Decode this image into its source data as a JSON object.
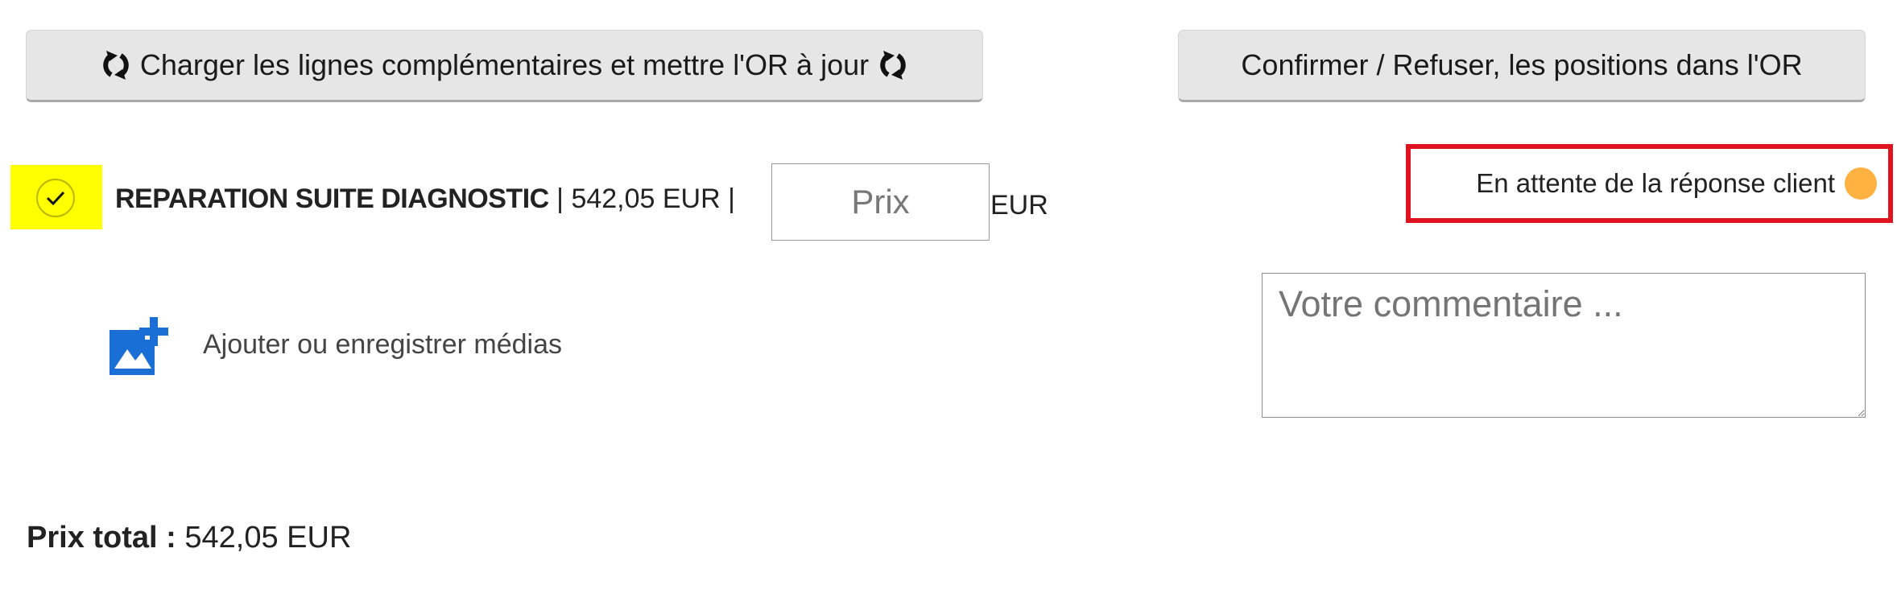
{
  "buttons": {
    "load_lines": "Charger les lignes complémentaires et mettre l'OR à jour",
    "confirm_refuse": "Confirmer / Refuser, les positions dans l'OR"
  },
  "line_item": {
    "title": "REPARATION SUITE DIAGNOSTIC",
    "separator_left": " | ",
    "price": "542,05 EUR",
    "separator_right": " |",
    "price_placeholder": "Prix",
    "price_value": "",
    "unit": "EUR",
    "checked": true
  },
  "status": {
    "text": "En attente de la réponse client",
    "dot_color": "#ffb23f",
    "highlight_color": "#e0141e"
  },
  "media": {
    "label": "Ajouter ou enregistrer médias",
    "icon": "add-photo-icon",
    "icon_color": "#1a6fd6"
  },
  "comment": {
    "placeholder": "Votre commentaire ...",
    "value": ""
  },
  "total": {
    "label": "Prix total :",
    "value": " 542,05 EUR"
  },
  "colors": {
    "check_highlight": "#ffff00",
    "button_bg": "#e6e6e6"
  }
}
